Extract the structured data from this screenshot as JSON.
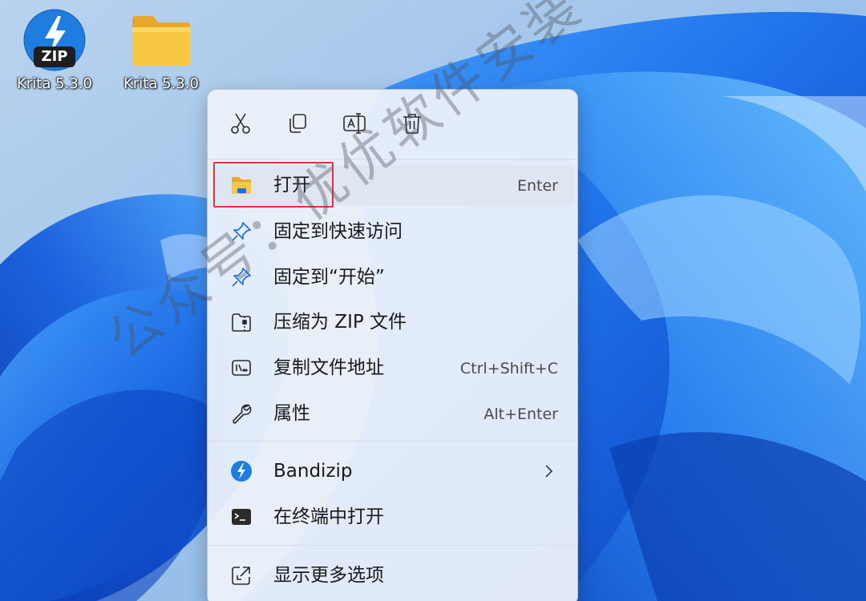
{
  "desktop": {
    "icons": [
      {
        "label": "Krita 5.3.0",
        "badge": "ZIP",
        "icon": "bandizip-zip-archive-icon"
      },
      {
        "label": "Krita 5.3.0",
        "icon": "folder-icon"
      }
    ]
  },
  "context_menu": {
    "quick_actions": [
      {
        "name": "cut",
        "icon": "scissors-icon"
      },
      {
        "name": "copy",
        "icon": "copy-icon"
      },
      {
        "name": "rename",
        "icon": "rename-icon"
      },
      {
        "name": "delete",
        "icon": "trash-icon"
      }
    ],
    "items": [
      {
        "label": "打开",
        "shortcut": "Enter",
        "icon": "folder-open-icon"
      },
      {
        "label": "固定到快速访问",
        "shortcut": "",
        "icon": "pin-icon"
      },
      {
        "label": "固定到“开始”",
        "shortcut": "",
        "icon": "pin-icon"
      },
      {
        "label": "压缩为 ZIP 文件",
        "shortcut": "",
        "icon": "zip-folder-icon"
      },
      {
        "label": "复制文件地址",
        "shortcut": "Ctrl+Shift+C",
        "icon": "copy-path-icon"
      },
      {
        "label": "属性",
        "shortcut": "Alt+Enter",
        "icon": "wrench-icon"
      },
      {
        "label": "Bandizip",
        "shortcut": "",
        "icon": "bandizip-icon",
        "has_submenu": true
      },
      {
        "label": "在终端中打开",
        "shortcut": "",
        "icon": "terminal-icon"
      },
      {
        "label": "显示更多选项",
        "shortcut": "",
        "icon": "show-more-icon"
      }
    ]
  },
  "watermark": "公众号：优优软件安装",
  "colors": {
    "accent": "#0067c0",
    "highlight_border": "#e0323b",
    "folder_yellow": "#f8c844",
    "wallpaper_blue": "#1f6fe0"
  }
}
